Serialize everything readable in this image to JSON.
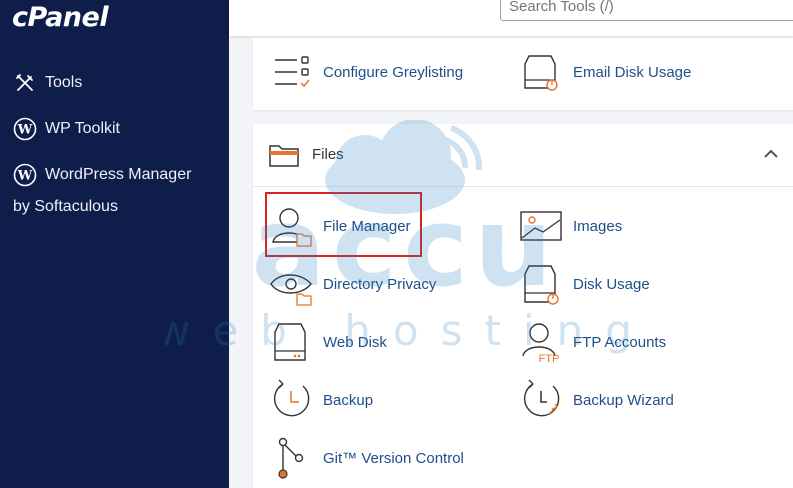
{
  "brand": {
    "logo_text": "cPanel"
  },
  "sidebar": {
    "items": [
      {
        "label": "Tools",
        "icon": "tools-icon"
      },
      {
        "label": "WP Toolkit",
        "icon": "wordpress-icon"
      },
      {
        "label": "WordPress Manager",
        "icon": "wordpress-icon"
      }
    ],
    "wpm_sub": "by Softaculous"
  },
  "search": {
    "placeholder": "Search Tools (/)"
  },
  "email_section": {
    "items": [
      {
        "label": "Configure Greylisting",
        "icon": "greylisting-icon"
      },
      {
        "label": "Email Disk Usage",
        "icon": "disk-usage-icon"
      }
    ]
  },
  "files_section": {
    "title": "Files",
    "items": [
      {
        "label": "File Manager",
        "icon": "file-manager-icon"
      },
      {
        "label": "Images",
        "icon": "images-icon"
      },
      {
        "label": "Directory Privacy",
        "icon": "directory-privacy-icon"
      },
      {
        "label": "Disk Usage",
        "icon": "disk-usage-icon"
      },
      {
        "label": "Web Disk",
        "icon": "web-disk-icon"
      },
      {
        "label": "FTP Accounts",
        "icon": "ftp-accounts-icon"
      },
      {
        "label": "Backup",
        "icon": "backup-icon"
      },
      {
        "label": "Backup Wizard",
        "icon": "backup-wizard-icon"
      },
      {
        "label": "Git™ Version Control",
        "icon": "git-icon"
      }
    ]
  },
  "watermark": {
    "line1": "accu",
    "line2": "web hosting"
  },
  "colors": {
    "sidebar": "#0f1d4b",
    "link": "#1f4f8b",
    "accent": "#e8712b",
    "highlight": "#d42424"
  }
}
